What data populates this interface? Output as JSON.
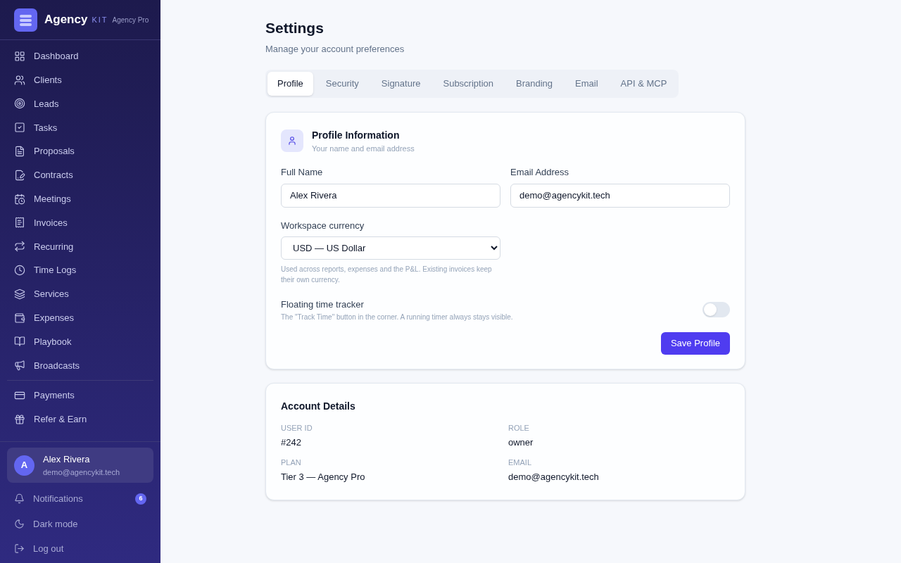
{
  "brand": {
    "name": "Agency",
    "suffix": "KIT",
    "plan": "Agency Pro"
  },
  "nav": {
    "groups": [
      [
        {
          "label": "Dashboard"
        },
        {
          "label": "Clients"
        },
        {
          "label": "Leads"
        },
        {
          "label": "Tasks"
        },
        {
          "label": "Proposals"
        },
        {
          "label": "Contracts"
        },
        {
          "label": "Meetings"
        },
        {
          "label": "Invoices"
        },
        {
          "label": "Recurring"
        },
        {
          "label": "Time Logs"
        },
        {
          "label": "Services"
        },
        {
          "label": "Expenses"
        },
        {
          "label": "Playbook"
        },
        {
          "label": "Broadcasts"
        }
      ],
      [
        {
          "label": "Payments"
        },
        {
          "label": "Refer & Earn"
        }
      ]
    ]
  },
  "user": {
    "initial": "A",
    "name": "Alex Rivera",
    "email": "demo@agencykit.tech"
  },
  "footer": [
    {
      "kind": "notifications",
      "label": "Notifications",
      "badge": "6"
    },
    {
      "kind": "dark",
      "label": "Dark mode"
    },
    {
      "kind": "logout",
      "label": "Log out"
    }
  ],
  "page": {
    "title": "Settings",
    "subtitle": "Manage your account preferences"
  },
  "tabs": [
    {
      "label": "Profile",
      "selected": true
    },
    {
      "label": "Security",
      "selected": false
    },
    {
      "label": "Signature",
      "selected": false
    },
    {
      "label": "Subscription",
      "selected": false
    },
    {
      "label": "Branding",
      "selected": false
    },
    {
      "label": "Email",
      "selected": false
    },
    {
      "label": "API & MCP",
      "selected": false
    }
  ],
  "profile": {
    "title": "Profile Information",
    "subtitle": "Your name and email address",
    "full_name": {
      "label": "Full Name",
      "value": "Alex Rivera"
    },
    "email": {
      "label": "Email Address",
      "value": "demo@agencykit.tech"
    },
    "currency": {
      "label": "Workspace currency",
      "value": "USD — US Dollar",
      "help": "Used across reports, expenses and the P&L. Existing invoices keep their own currency."
    },
    "tracker": {
      "label": "Floating time tracker",
      "help": "The \"Track Time\" button in the corner. A running timer always stays visible.",
      "on": false
    },
    "save": "Save Profile"
  },
  "account": {
    "title": "Account Details",
    "fields": [
      {
        "label": "USER ID",
        "value": "#242"
      },
      {
        "label": "ROLE",
        "value": "owner"
      },
      {
        "label": "PLAN",
        "value": "Tier 3 — Agency Pro"
      },
      {
        "label": "EMAIL",
        "value": "demo@agencykit.tech"
      }
    ]
  }
}
